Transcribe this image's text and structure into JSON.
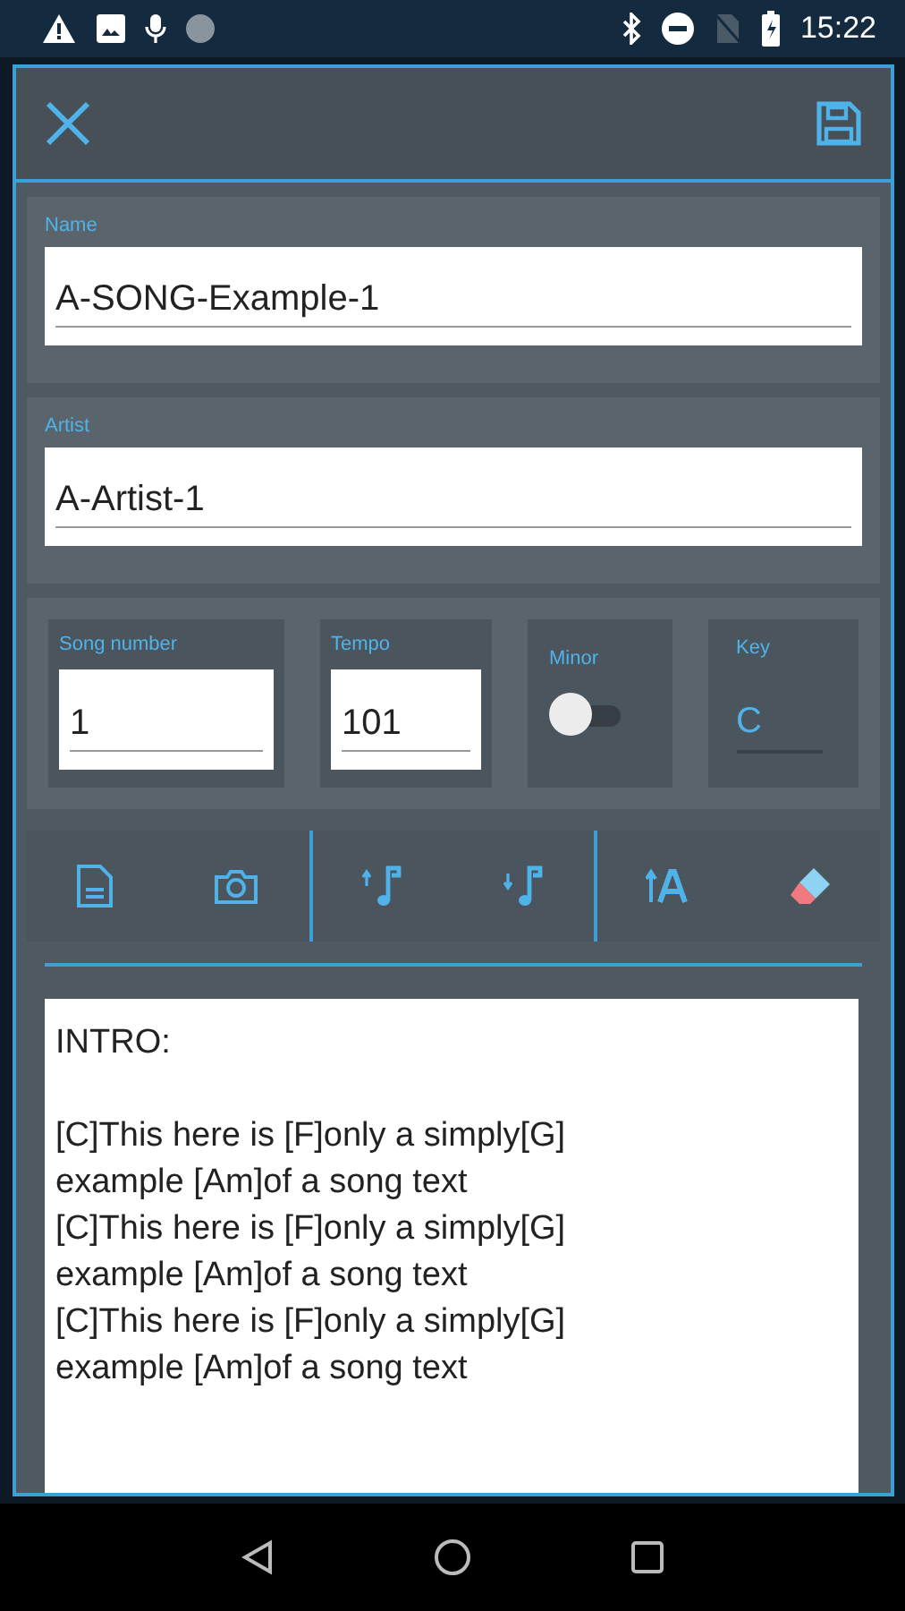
{
  "status_bar": {
    "time": "15:22"
  },
  "fields": [
    {
      "label": "Name",
      "value": "A-SONG-Example-1"
    },
    {
      "label": "Artist",
      "value": "A-Artist-1"
    }
  ],
  "details": [
    {
      "kind": "input",
      "label": "Song number",
      "value": "1"
    },
    {
      "kind": "input",
      "label": "Tempo",
      "value": "101"
    },
    {
      "kind": "switch",
      "label": "Minor",
      "on": false
    },
    {
      "kind": "select",
      "label": "Key",
      "value": "C"
    }
  ],
  "lyrics": "INTRO:\n\n[C]This here is [F]only a simply[G]\nexample [Am]of a song text\n[C]This here is [F]only a simply[G]\nexample [Am]of a song text\n[C]This here is [F]only a simply[G]\nexample [Am]of a song text"
}
